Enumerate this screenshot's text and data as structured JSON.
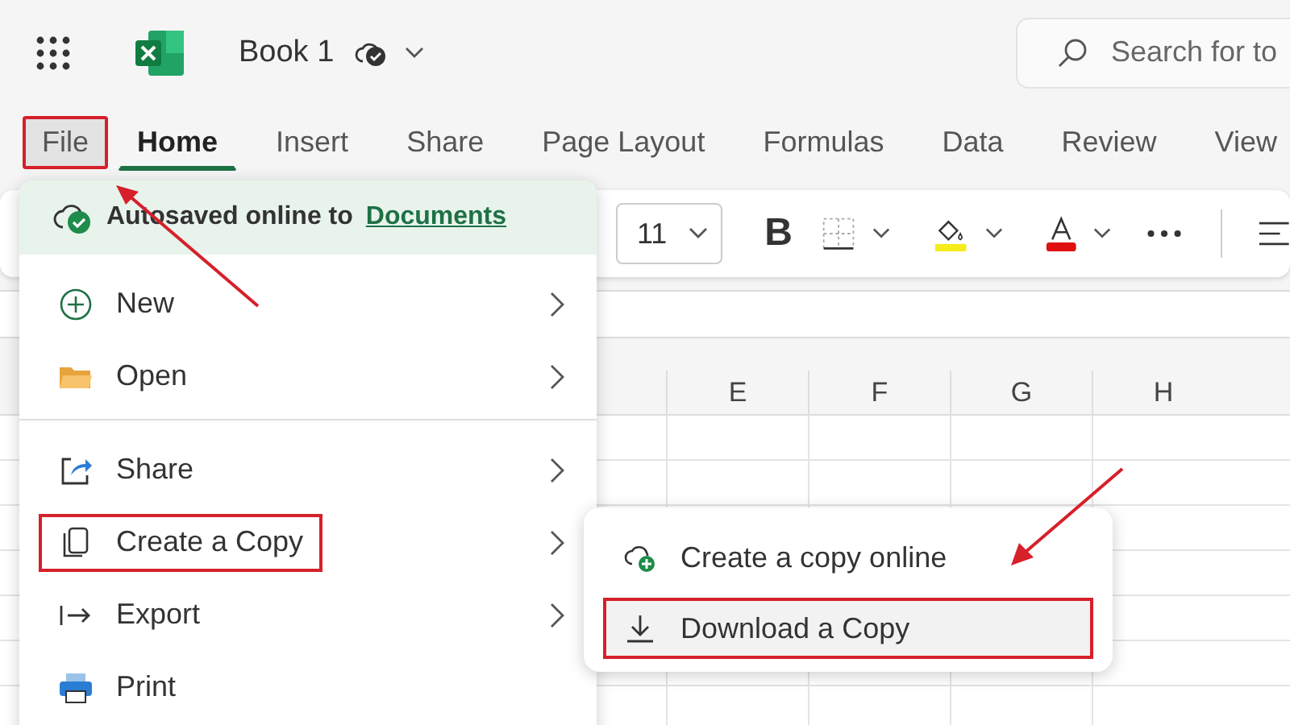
{
  "app_bar": {
    "title": "Book 1",
    "search": {
      "placeholder": "Search for to"
    }
  },
  "ribbon_tabs": [
    {
      "label": "File",
      "selected": false,
      "open": true,
      "highlighted": true
    },
    {
      "label": "Home",
      "selected": true,
      "open": false,
      "highlighted": false
    },
    {
      "label": "Insert",
      "selected": false,
      "open": false,
      "highlighted": false
    },
    {
      "label": "Share",
      "selected": false,
      "open": false,
      "highlighted": false
    },
    {
      "label": "Page Layout",
      "selected": false,
      "open": false,
      "highlighted": false
    },
    {
      "label": "Formulas",
      "selected": false,
      "open": false,
      "highlighted": false
    },
    {
      "label": "Data",
      "selected": false,
      "open": false,
      "highlighted": false
    },
    {
      "label": "Review",
      "selected": false,
      "open": false,
      "highlighted": false
    },
    {
      "label": "View",
      "selected": false,
      "open": false,
      "highlighted": false
    }
  ],
  "toolbar": {
    "font_size": "11",
    "bold_label": "B"
  },
  "columns": [
    "E",
    "F",
    "G",
    "H"
  ],
  "file_menu": {
    "status": "Autosaved online to",
    "status_link": "Documents",
    "groups": [
      [
        {
          "label": "New",
          "kind": "new",
          "submenu": true,
          "highlighted": false
        },
        {
          "label": "Open",
          "kind": "open",
          "submenu": true,
          "highlighted": false
        }
      ],
      [
        {
          "label": "Share",
          "kind": "share",
          "submenu": true,
          "highlighted": false
        },
        {
          "label": "Create a Copy",
          "kind": "copy",
          "submenu": true,
          "highlighted": true
        },
        {
          "label": "Export",
          "kind": "export",
          "submenu": true,
          "highlighted": false
        },
        {
          "label": "Print",
          "kind": "print",
          "submenu": false,
          "highlighted": false
        }
      ]
    ]
  },
  "copy_submenu": [
    {
      "label": "Create a copy online",
      "kind": "cloud-add",
      "highlighted": false
    },
    {
      "label": "Download a Copy",
      "kind": "download",
      "highlighted": true
    }
  ]
}
